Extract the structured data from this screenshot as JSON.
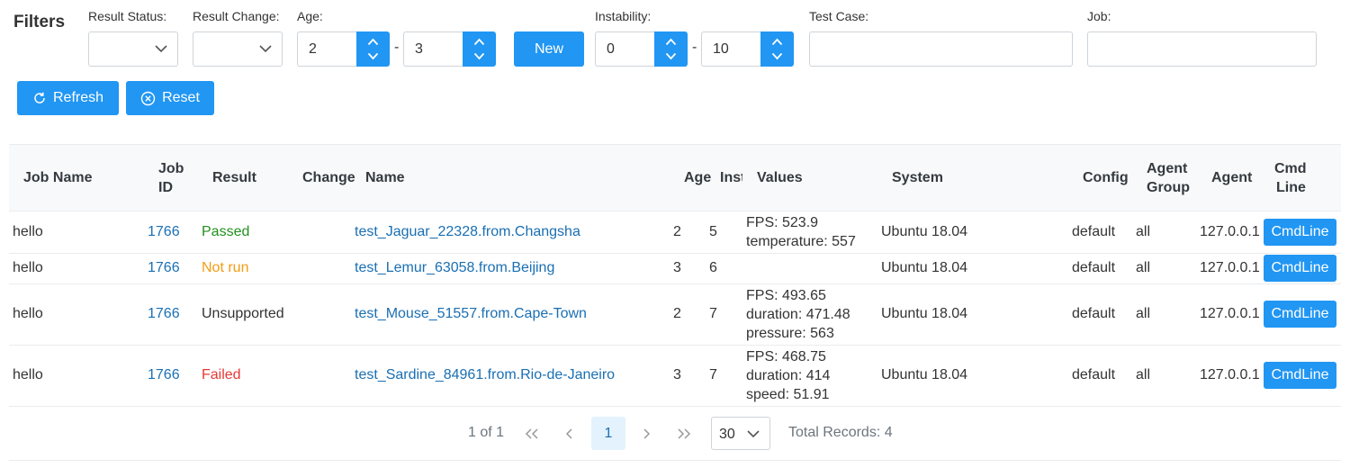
{
  "filters": {
    "title": "Filters",
    "result_status": {
      "label": "Result Status:",
      "value": ""
    },
    "result_change": {
      "label": "Result Change:",
      "value": ""
    },
    "age": {
      "label": "Age:",
      "min": "2",
      "max": "3"
    },
    "new_button": "New",
    "instability": {
      "label": "Instability:",
      "min": "0",
      "max": "10"
    },
    "test_case": {
      "label": "Test Case:",
      "value": ""
    },
    "job": {
      "label": "Job:",
      "value": ""
    },
    "range_separator": "-",
    "refresh_button": "Refresh",
    "reset_button": "Reset"
  },
  "table": {
    "columns": {
      "job_name": "Job Name",
      "job_id_1": "Job",
      "job_id_2": "ID",
      "result": "Result",
      "change": "Change",
      "name": "Name",
      "age": "Age",
      "instability": "Inst",
      "values": "Values",
      "system": "System",
      "config": "Config",
      "agent_group_1": "Agent",
      "agent_group_2": "Group",
      "agent": "Agent",
      "cmdline_1": "Cmd",
      "cmdline_2": "Line"
    },
    "rows": [
      {
        "job_name": "hello",
        "job_id": "1766",
        "result": "Passed",
        "change": "",
        "name": "test_Jaguar_22328.from.Changsha",
        "age": "2",
        "instability": "5",
        "values": [
          "FPS: 523.9",
          "temperature: 557"
        ],
        "system": "Ubuntu 18.04",
        "config": "default",
        "agent_group": "all",
        "agent": "127.0.0.1",
        "cmdline": "CmdLine"
      },
      {
        "job_name": "hello",
        "job_id": "1766",
        "result": "Not run",
        "change": "",
        "name": "test_Lemur_63058.from.Beijing",
        "age": "3",
        "instability": "6",
        "values": [],
        "system": "Ubuntu 18.04",
        "config": "default",
        "agent_group": "all",
        "agent": "127.0.0.1",
        "cmdline": "CmdLine"
      },
      {
        "job_name": "hello",
        "job_id": "1766",
        "result": "Unsupported",
        "change": "",
        "name": "test_Mouse_51557.from.Cape-Town",
        "age": "2",
        "instability": "7",
        "values": [
          "FPS: 493.65",
          "duration: 471.48",
          "pressure: 563"
        ],
        "system": "Ubuntu 18.04",
        "config": "default",
        "agent_group": "all",
        "agent": "127.0.0.1",
        "cmdline": "CmdLine"
      },
      {
        "job_name": "hello",
        "job_id": "1766",
        "result": "Failed",
        "change": "",
        "name": "test_Sardine_84961.from.Rio-de-Janeiro",
        "age": "3",
        "instability": "7",
        "values": [
          "FPS: 468.75",
          "duration: 414",
          "speed: 51.91"
        ],
        "system": "Ubuntu 18.04",
        "config": "default",
        "agent_group": "all",
        "agent": "127.0.0.1",
        "cmdline": "CmdLine"
      }
    ]
  },
  "pagination": {
    "page_report": "1 of 1",
    "current_page": "1",
    "rows_per_page": "30",
    "total_records": "Total Records: 4"
  },
  "colors": {
    "primary": "#2196f3",
    "link": "#1a6fb3",
    "passed": "#22901f",
    "not_run": "#f39c12",
    "failed": "#e53935"
  }
}
